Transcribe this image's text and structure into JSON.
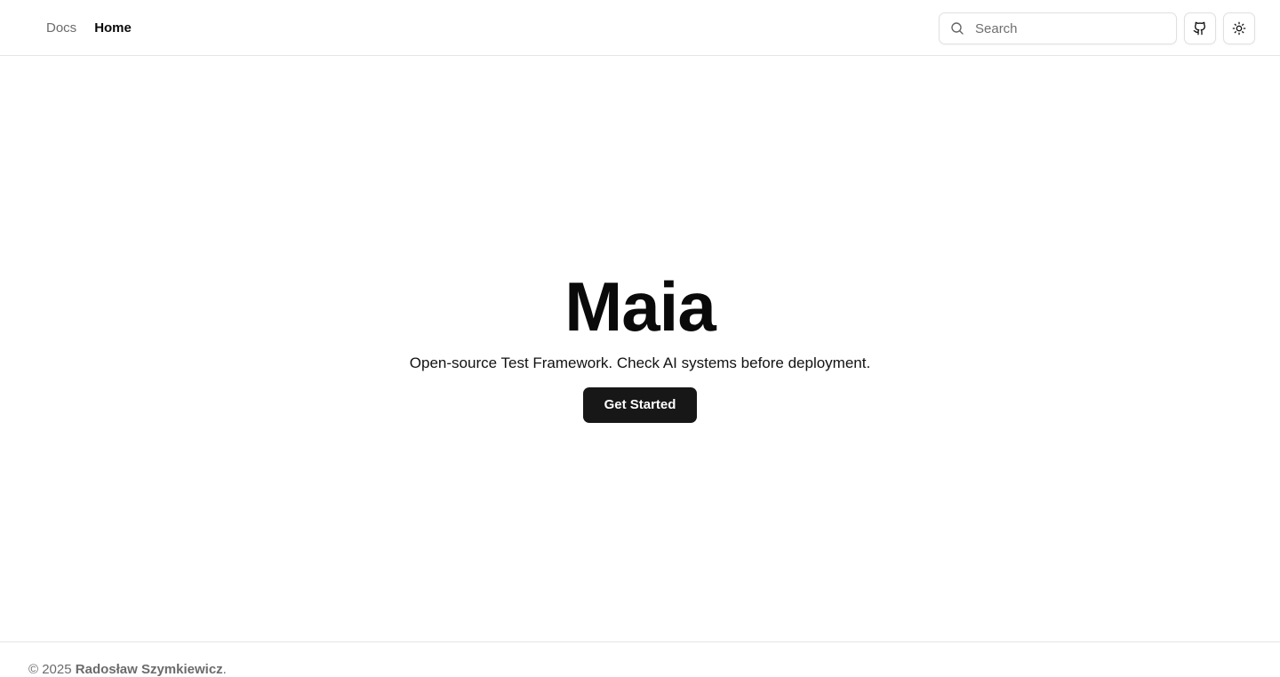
{
  "nav": {
    "items": [
      {
        "label": "Docs",
        "active": false
      },
      {
        "label": "Home",
        "active": true
      }
    ]
  },
  "search": {
    "placeholder": "Search",
    "icon": "search-icon"
  },
  "toolbar": {
    "github_icon": "github-icon",
    "theme_icon": "sun-icon"
  },
  "hero": {
    "title": "Maia",
    "subtitle": "Open-source Test Framework. Check AI systems before deployment.",
    "cta_label": "Get Started"
  },
  "footer": {
    "prefix": "© 2025 ",
    "author": "Radosław Szymkiewicz",
    "suffix": "."
  },
  "colors": {
    "primary_button": "#171717",
    "border": "#e5e5e5",
    "muted_text": "#6b6b6b"
  }
}
